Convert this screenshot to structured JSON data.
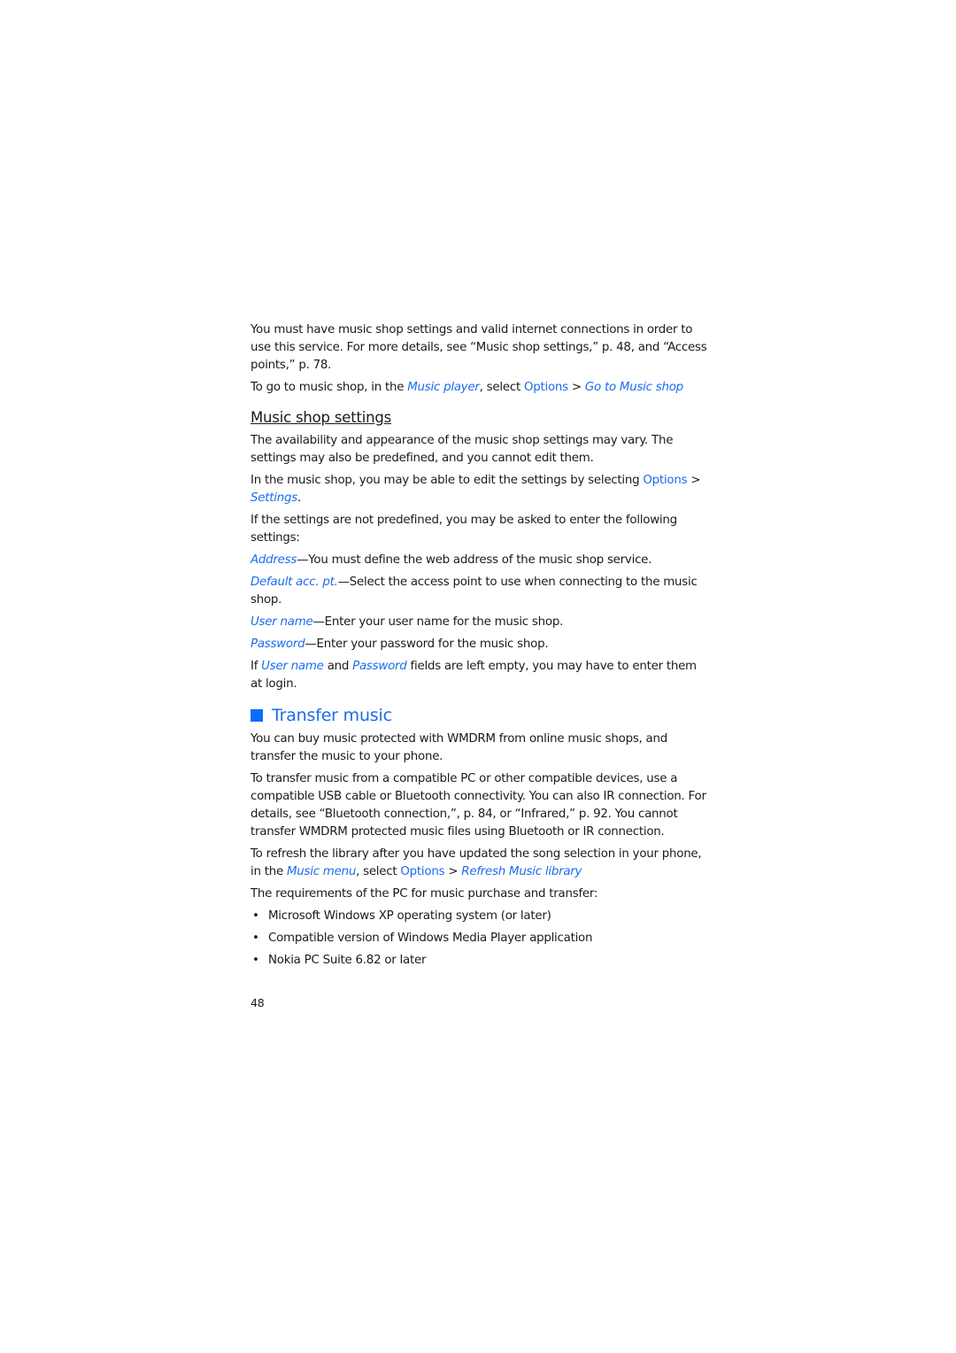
{
  "intro": {
    "p1": "You must have music shop settings and valid internet connections in order to use this service. For more details, see “Music shop settings,” p. 48, and “Access points,” p. 78.",
    "p2_a": "To go to music shop, in the ",
    "p2_link1": "Music player",
    "p2_b": ", select ",
    "p2_opt": "Options",
    "p2_c": " > ",
    "p2_link2": "Go to Music shop"
  },
  "settings_section": {
    "title": "Music shop settings",
    "p1": "The availability and appearance of the music shop settings may vary. The settings may also be predefined, and you cannot edit them.",
    "p2_a": "In the music shop, you may be able to edit the settings by selecting ",
    "p2_opt": "Options",
    "p2_b": " > ",
    "p2_link": "Settings",
    "p2_c": ".",
    "p3": "If the settings are not predefined, you may be asked to enter the following settings:",
    "items": [
      {
        "term": "Address",
        "desc": "—You must define the web address of the music shop service."
      },
      {
        "term": "Default acc. pt.",
        "desc": "—Select the access point to use when connecting to the music shop."
      },
      {
        "term": "User name",
        "desc": "—Enter your user name for the music shop."
      },
      {
        "term": "Password",
        "desc": "—Enter your password for the music shop."
      }
    ],
    "p4_a": "If ",
    "p4_t1": "User name",
    "p4_b": " and ",
    "p4_t2": "Password",
    "p4_c": " fields are left empty, you may have to enter them at login."
  },
  "transfer_section": {
    "title": "Transfer music",
    "p1": "You can buy music protected with WMDRM from online music shops, and transfer the music to your phone.",
    "p2": "To transfer music from a compatible PC or other compatible devices, use a compatible USB cable or Bluetooth connectivity. You can also IR connection. For details, see “Bluetooth connection,”, p. 84, or “Infrared,” p. 92. You cannot transfer WMDRM protected music files using Bluetooth or IR connection.",
    "p3_a": "To refresh the library after you have updated the song selection in your phone, in the ",
    "p3_link1": "Music menu",
    "p3_b": ", select ",
    "p3_opt": "Options",
    "p3_c": " > ",
    "p3_link2": "Refresh Music library",
    "p4": "The requirements of the PC for music purchase and transfer:",
    "bullet": "•",
    "requirements": [
      "Microsoft Windows XP operating system (or later)",
      "Compatible version of Windows Media Player application",
      "Nokia PC Suite 6.82 or later"
    ]
  },
  "page_number": "48"
}
